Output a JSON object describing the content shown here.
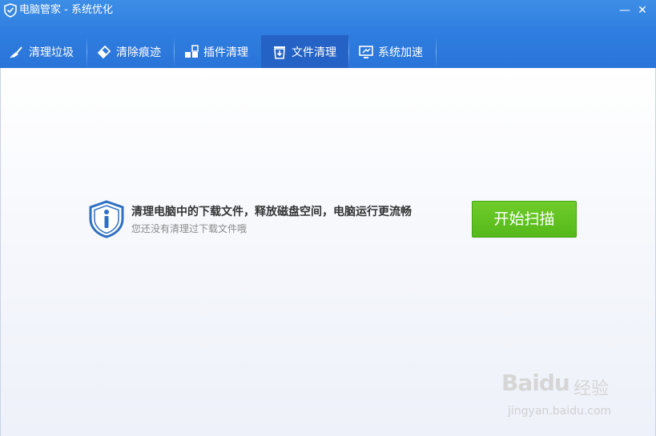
{
  "window": {
    "title": "电脑管家 - 系统优化",
    "minimize_symbol": "—",
    "close_symbol": "✕"
  },
  "tabs": [
    {
      "label": "清理垃圾",
      "icon": "broom-icon",
      "active": false
    },
    {
      "label": "清除痕迹",
      "icon": "eraser-icon",
      "active": false
    },
    {
      "label": "插件清理",
      "icon": "puzzle-icon",
      "active": false
    },
    {
      "label": "文件清理",
      "icon": "download-trash-icon",
      "active": true
    },
    {
      "label": "系统加速",
      "icon": "monitor-speed-icon",
      "active": false
    }
  ],
  "main": {
    "headline": "清理电脑中的下载文件，释放磁盘空间，电脑运行更流畅",
    "subtext": "您还没有清理过下载文件哦",
    "scan_button": "开始扫描",
    "shield_icon": "shield-info-icon"
  },
  "watermark": {
    "logo": "Baidu",
    "cn": "经验",
    "url": "jingyan.baidu.com"
  },
  "colors": {
    "header": "#2f7ee0",
    "active_tab": "#2562c6",
    "scan_button": "#5cbf1f"
  }
}
